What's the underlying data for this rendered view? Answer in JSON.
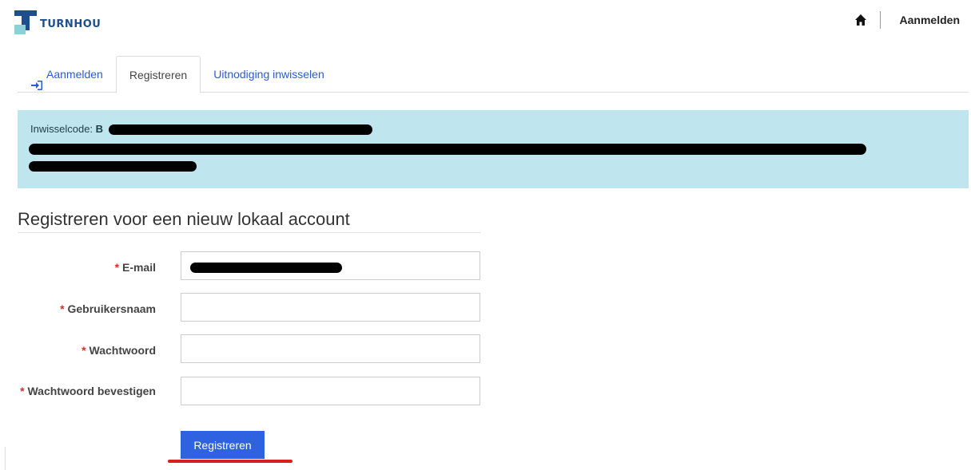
{
  "header": {
    "logo_text": "TURNHOU",
    "home_icon": "home-icon",
    "signin_label": "Aanmelden"
  },
  "tabs": [
    {
      "label": "Aanmelden",
      "icon": "sign-in-icon",
      "active": false
    },
    {
      "label": "Registreren",
      "active": true
    },
    {
      "label": "Uitnodiging inwisselen",
      "active": false
    }
  ],
  "alert": {
    "label": "Inwisselcode:",
    "code_prefix": "B"
  },
  "form": {
    "title": "Registreren voor een nieuw lokaal account",
    "required_mark": "*",
    "fields": [
      {
        "label": "E-mail",
        "value": ""
      },
      {
        "label": "Gebruikersnaam",
        "value": ""
      },
      {
        "label": "Wachtwoord",
        "value": ""
      },
      {
        "label": "Wachtwoord bevestigen",
        "value": ""
      }
    ],
    "submit_label": "Registreren"
  },
  "colors": {
    "brand": "#1e4f8c",
    "link": "#2a5bd7",
    "alert_bg": "#bfe5ee",
    "button": "#2f62e0",
    "required": "#c9342c",
    "annotation": "#d6201f"
  }
}
